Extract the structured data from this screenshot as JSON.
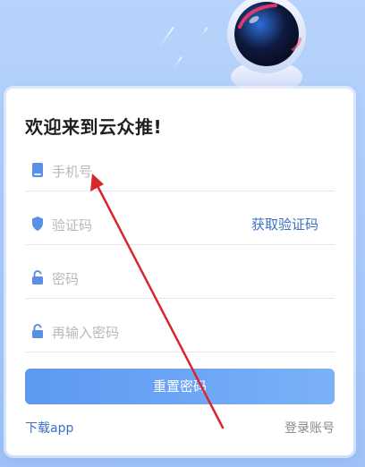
{
  "form": {
    "title": "欢迎来到云众推!",
    "fields": [
      {
        "icon": "phone-icon",
        "placeholder": "手机号"
      },
      {
        "icon": "shield-icon",
        "placeholder": "验证码",
        "action": "获取验证码"
      },
      {
        "icon": "lock-icon",
        "placeholder": "密码"
      },
      {
        "icon": "lock-icon",
        "placeholder": "再输入密码"
      }
    ],
    "submit_label": "重置密码",
    "download_label": "下载app",
    "login_label": "登录账号"
  },
  "colors": {
    "accent": "#3b6fc7",
    "button_start": "#5b99f2",
    "button_end": "#7cb1f7",
    "background": "#b7d3fb",
    "annotation_arrow": "#d8262c"
  }
}
